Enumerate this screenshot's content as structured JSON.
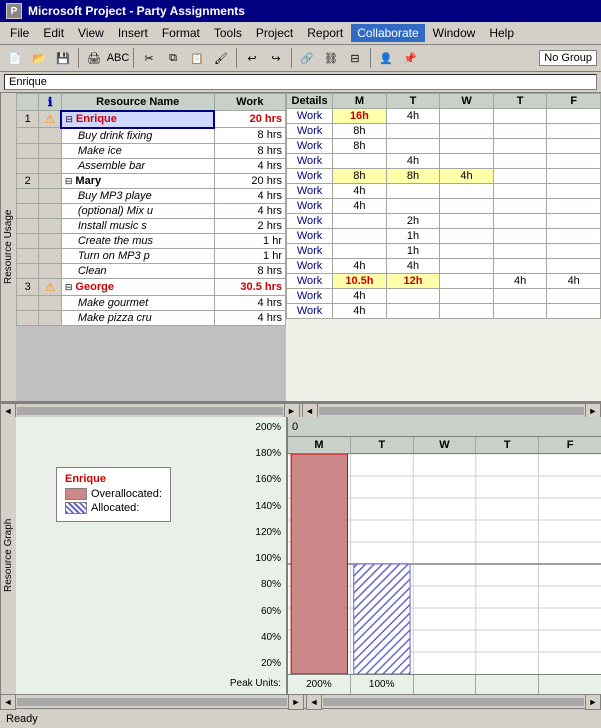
{
  "titleBar": {
    "icon": "MS",
    "title": "Microsoft Project - Party Assignments"
  },
  "menuBar": {
    "items": [
      "File",
      "Edit",
      "View",
      "Insert",
      "Format",
      "Tools",
      "Project",
      "Report",
      "Collaborate",
      "Window",
      "Help"
    ]
  },
  "toolbar": {
    "noGroupLabel": "No Group"
  },
  "formulaBar": {
    "value": "Enrique"
  },
  "upperTable": {
    "columns": [
      "",
      "",
      "Resource Name",
      "Work"
    ],
    "detailsLabel": "Details",
    "days": [
      "M",
      "T",
      "W",
      "T",
      "F"
    ],
    "rows": [
      {
        "num": "1",
        "icon": "warning",
        "name": "Enrique",
        "isResource": true,
        "work": "20 hrs",
        "overalloc": true,
        "detail": "Work",
        "values": [
          "16h",
          "4h",
          "",
          "",
          ""
        ]
      },
      {
        "num": "",
        "icon": "",
        "name": "Buy drink fixing",
        "isResource": false,
        "work": "8 hrs",
        "overalloc": false,
        "detail": "Work",
        "values": [
          "8h",
          "",
          "",
          "",
          ""
        ]
      },
      {
        "num": "",
        "icon": "",
        "name": "Make ice",
        "isResource": false,
        "work": "8 hrs",
        "overalloc": false,
        "detail": "Work",
        "values": [
          "8h",
          "",
          "",
          "",
          ""
        ]
      },
      {
        "num": "",
        "icon": "",
        "name": "Assemble bar",
        "isResource": false,
        "work": "4 hrs",
        "overalloc": false,
        "detail": "Work",
        "values": [
          "",
          "4h",
          "",
          "",
          ""
        ]
      },
      {
        "num": "2",
        "icon": "",
        "name": "Mary",
        "isResource": true,
        "work": "20 hrs",
        "overalloc": false,
        "detail": "Work",
        "values": [
          "8h",
          "8h",
          "4h",
          "",
          ""
        ]
      },
      {
        "num": "",
        "icon": "",
        "name": "Buy MP3 playe",
        "isResource": false,
        "work": "4 hrs",
        "overalloc": false,
        "detail": "Work",
        "values": [
          "4h",
          "",
          "",
          "",
          ""
        ]
      },
      {
        "num": "",
        "icon": "",
        "name": "(optional) Mix u",
        "isResource": false,
        "work": "4 hrs",
        "overalloc": false,
        "detail": "Work",
        "values": [
          "4h",
          "",
          "",
          "",
          ""
        ]
      },
      {
        "num": "",
        "icon": "",
        "name": "Install music s",
        "isResource": false,
        "work": "2 hrs",
        "overalloc": false,
        "detail": "Work",
        "values": [
          "",
          "2h",
          "",
          "",
          ""
        ]
      },
      {
        "num": "",
        "icon": "",
        "name": "Create the mus",
        "isResource": false,
        "work": "1 hr",
        "overalloc": false,
        "detail": "Work",
        "values": [
          "",
          "1h",
          "",
          "",
          ""
        ]
      },
      {
        "num": "",
        "icon": "",
        "name": "Turn on MP3 p",
        "isResource": false,
        "work": "1 hr",
        "overalloc": false,
        "detail": "Work",
        "values": [
          "",
          "1h",
          "",
          "",
          ""
        ]
      },
      {
        "num": "",
        "icon": "",
        "name": "Clean",
        "isResource": false,
        "work": "8 hrs",
        "overalloc": false,
        "detail": "Work",
        "values": [
          "4h",
          "4h",
          "",
          "",
          ""
        ]
      },
      {
        "num": "3",
        "icon": "warning",
        "name": "George",
        "isResource": true,
        "work": "30.5 hrs",
        "overalloc": true,
        "detail": "Work",
        "values": [
          "10.5h",
          "12h",
          "",
          "4h",
          "4h"
        ]
      },
      {
        "num": "",
        "icon": "",
        "name": "Make gourmet",
        "isResource": false,
        "work": "4 hrs",
        "overalloc": false,
        "detail": "Work",
        "values": [
          "4h",
          "",
          "",
          "",
          ""
        ]
      },
      {
        "num": "",
        "icon": "",
        "name": "Make pizza cru",
        "isResource": false,
        "work": "4 hrs",
        "overalloc": false,
        "detail": "Work",
        "values": [
          "4h",
          "",
          "",
          "",
          ""
        ]
      }
    ]
  },
  "lowerGraph": {
    "legend": {
      "title": "Enrique",
      "overallocLabel": "Overallocated:",
      "allocLabel": "Allocated:"
    },
    "yLabels": [
      "200%",
      "180%",
      "160%",
      "140%",
      "120%",
      "100%",
      "80%",
      "60%",
      "40%",
      "20%"
    ],
    "peakUnitsLabel": "Peak Units:",
    "days": [
      "M",
      "T",
      "W",
      "T",
      "F"
    ],
    "bars": {
      "M": {
        "overalloc": 200,
        "alloc": 0
      },
      "T": {
        "overalloc": 0,
        "alloc": 100
      },
      "W": {
        "overalloc": 0,
        "alloc": 0
      },
      "T2": {
        "overalloc": 0,
        "alloc": 0
      },
      "F": {
        "overalloc": 0,
        "alloc": 0
      }
    },
    "peakValues": [
      "200%",
      "100%",
      "",
      "",
      ""
    ]
  },
  "statusBar": {
    "text": "Ready"
  }
}
